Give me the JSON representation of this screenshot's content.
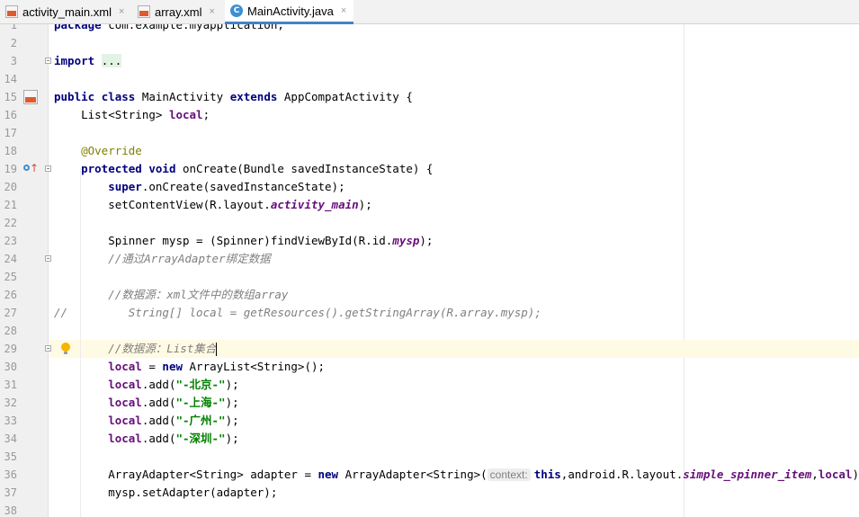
{
  "tabs": [
    {
      "label": "activity_main.xml",
      "icon": "xml-file-icon",
      "active": false
    },
    {
      "label": "array.xml",
      "icon": "xml-file-icon",
      "active": false
    },
    {
      "label": "MainActivity.java",
      "icon": "java-class-icon",
      "active": true
    }
  ],
  "tab_close": "×",
  "lines": {
    "l1": {
      "n": "1",
      "pkg": "package",
      "t": " com.example.myapplication;"
    },
    "l2": {
      "n": "2"
    },
    "l3": {
      "n": "3",
      "imp": "import",
      "dots": "..."
    },
    "l14": {
      "n": "14"
    },
    "l15": {
      "n": "15",
      "k1": "public",
      "k2": "class",
      "cls": " MainActivity ",
      "k3": "extends",
      "rest": " AppCompatActivity {"
    },
    "l16": {
      "n": "16",
      "pre": "    List<String> ",
      "fld": "local",
      "post": ";"
    },
    "l17": {
      "n": "17"
    },
    "l18": {
      "n": "18",
      "ann": "    @Override"
    },
    "l19": {
      "n": "19",
      "k1": "    protected",
      "k2": " void",
      "rest": " onCreate(Bundle savedInstanceState) {"
    },
    "l20": {
      "n": "20",
      "k1": "        super",
      "rest": ".onCreate(savedInstanceState);"
    },
    "l21": {
      "n": "21",
      "pre": "        setContentView(R.layout.",
      "fi": "activity_main",
      "post": ");"
    },
    "l22": {
      "n": "22"
    },
    "l23": {
      "n": "23",
      "pre": "        Spinner mysp = (Spinner)findViewById(R.id.",
      "fi": "mysp",
      "post": ");"
    },
    "l24": {
      "n": "24",
      "cmt": "        //通过ArrayAdapter绑定数据"
    },
    "l25": {
      "n": "25"
    },
    "l26": {
      "n": "26",
      "cmt": "        //数据源：xml文件中的数组array"
    },
    "l27": {
      "n": "27",
      "cmt": "//         String[] local = getResources().getStringArray(R.array.mysp);"
    },
    "l28": {
      "n": "28"
    },
    "l29": {
      "n": "29",
      "cmt": "        //数据源：List集合"
    },
    "l30": {
      "n": "30",
      "fld": "        local",
      "mid": " = ",
      "kw": "new",
      "rest": " ArrayList<String>();"
    },
    "l31": {
      "n": "31",
      "fld": "        local",
      "pre": ".add(",
      "str": "\"-北京-\"",
      "post": ");"
    },
    "l32": {
      "n": "32",
      "fld": "        local",
      "pre": ".add(",
      "str": "\"-上海-\"",
      "post": ");"
    },
    "l33": {
      "n": "33",
      "fld": "        local",
      "pre": ".add(",
      "str": "\"-广州-\"",
      "post": ");"
    },
    "l34": {
      "n": "34",
      "fld": "        local",
      "pre": ".add(",
      "str": "\"-深圳-\"",
      "post": ");"
    },
    "l35": {
      "n": "35"
    },
    "l36": {
      "n": "36",
      "pre": "        ArrayAdapter<String> adapter = ",
      "kw": "new",
      "mid": " ArrayAdapter<String>(",
      "hint": "context:",
      "kw2": "this",
      "mid2": ",android.R.layout.",
      "fi": "simple_spinner_item",
      "sep": ",",
      "fld": "local",
      "post": ");"
    },
    "l37": {
      "n": "37",
      "t": "        mysp.setAdapter(adapter);"
    },
    "l38": {
      "n": "38"
    }
  },
  "colors": {
    "keyword": "#000080",
    "field": "#660e7a",
    "string": "#008000",
    "comment": "#808080",
    "annotation": "#808000",
    "caret_line": "#fffae3",
    "tab_accent": "#4083c9"
  }
}
